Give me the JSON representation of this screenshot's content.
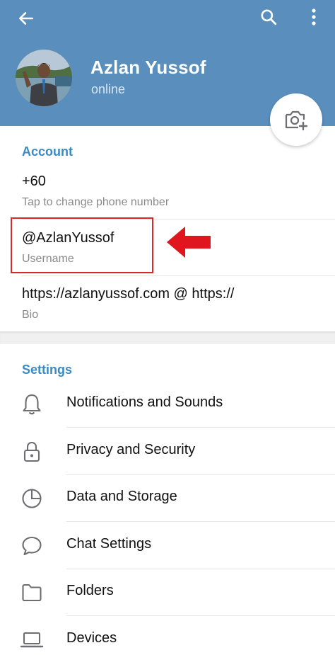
{
  "profile": {
    "name": "Azlan Yussof",
    "status": "online"
  },
  "header_icons": {
    "back": "arrow-left-icon",
    "search": "search-icon",
    "more": "more-vertical-icon",
    "camera": "camera-add-icon"
  },
  "account": {
    "title": "Account",
    "phone_value": "+60",
    "phone_caption": "Tap to change phone number",
    "username_value": "@AzlanYussof",
    "username_caption": "Username",
    "bio_value": "https://azlanyussof.com @ https://",
    "bio_caption": "Bio"
  },
  "annotation": {
    "highlight_color": "#d62a2a",
    "arrow_color": "#e0161e"
  },
  "settings": {
    "title": "Settings",
    "items": [
      {
        "label": "Notifications and Sounds",
        "icon": "bell-icon"
      },
      {
        "label": "Privacy and Security",
        "icon": "lock-icon"
      },
      {
        "label": "Data and Storage",
        "icon": "pie-chart-icon"
      },
      {
        "label": "Chat Settings",
        "icon": "chat-bubble-icon"
      },
      {
        "label": "Folders",
        "icon": "folder-icon"
      },
      {
        "label": "Devices",
        "icon": "laptop-icon"
      }
    ]
  },
  "colors": {
    "header_bg": "#5a8fbd",
    "accent": "#3a8bc4"
  }
}
